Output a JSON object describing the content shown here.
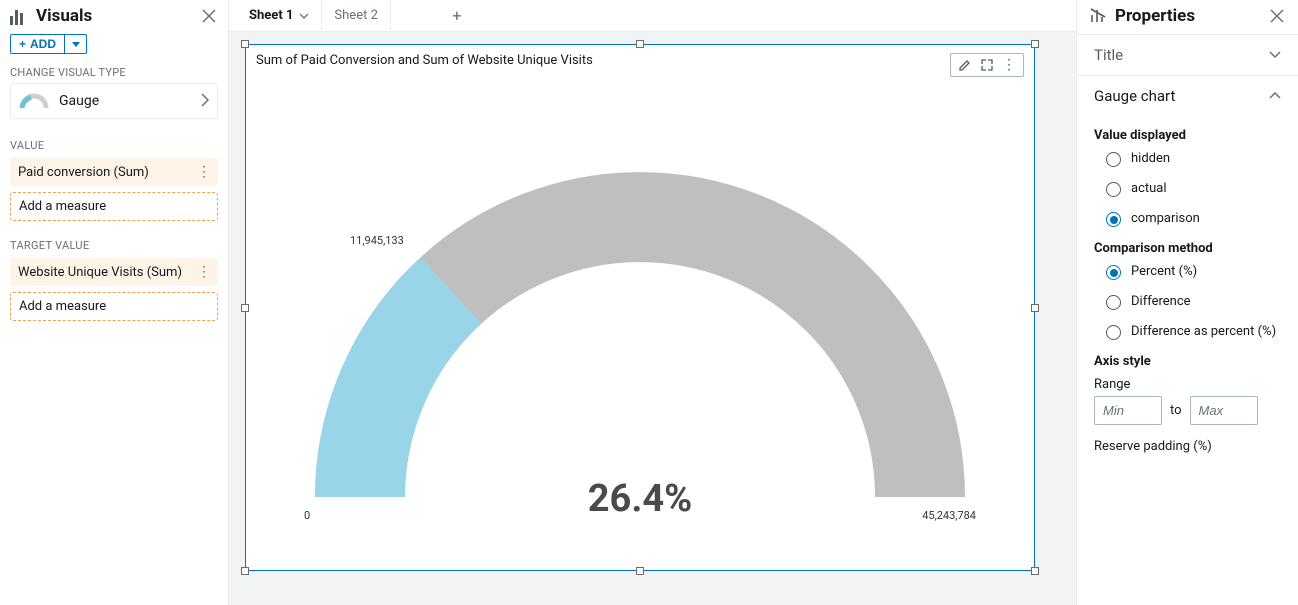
{
  "left": {
    "title": "Visuals",
    "add": "ADD",
    "change_type_label": "CHANGE VISUAL TYPE",
    "visual_type": "Gauge",
    "value_label": "VALUE",
    "value_field": "Paid conversion (Sum)",
    "add_measure": "Add a measure",
    "target_label": "TARGET VALUE",
    "target_field": "Website Unique Visits (Sum)"
  },
  "tabs": {
    "items": [
      {
        "label": "Sheet 1",
        "active": true
      },
      {
        "label": "Sheet 2",
        "active": false
      }
    ]
  },
  "visual": {
    "title": "Sum of Paid Conversion and Sum of Website Unique Visits"
  },
  "right": {
    "title": "Properties",
    "sections": {
      "title": "Title",
      "gauge": "Gauge chart"
    },
    "value_displayed": {
      "label": "Value displayed",
      "options": {
        "hidden": "hidden",
        "actual": "actual",
        "comparison": "comparison"
      },
      "selected": "comparison"
    },
    "comparison_method": {
      "label": "Comparison method",
      "options": {
        "percent": "Percent (%)",
        "difference": "Difference",
        "difference_percent": "Difference as percent (%)"
      },
      "selected": "percent"
    },
    "axis_style": {
      "label": "Axis style",
      "range_label": "Range",
      "min_placeholder": "Min",
      "max_placeholder": "Max",
      "to": "to",
      "reserve_label": "Reserve padding (%)"
    }
  },
  "chart_data": {
    "type": "gauge",
    "value": 11945133,
    "target": 45243784,
    "min": 0,
    "max": 45243784,
    "percent": 26.4,
    "value_label": "11,945,133",
    "min_label": "0",
    "max_label": "45,243,784",
    "center_label": "26.4%",
    "fill_color": "#99d5e8",
    "background_color": "#bfbfbf"
  }
}
